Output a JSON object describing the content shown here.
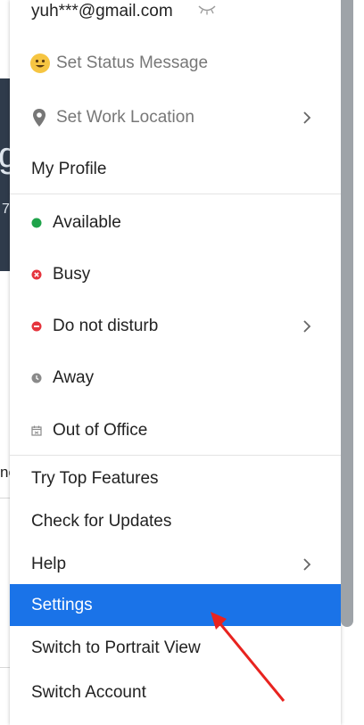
{
  "account": {
    "email": "yuh***@gmail.com"
  },
  "menu": {
    "set_status": "Set Status Message",
    "set_work_location": "Set Work Location",
    "my_profile": "My Profile",
    "presence": [
      {
        "label": "Available",
        "color": "#1fa34a"
      },
      {
        "label": "Busy",
        "color": "#e5343d"
      },
      {
        "label": "Do not disturb",
        "color": "#e5343d"
      },
      {
        "label": "Away",
        "color": "#8a8a8a"
      },
      {
        "label": "Out of Office",
        "color": "#8a8a8a"
      }
    ],
    "try_top_features": "Try Top Features",
    "check_updates": "Check for Updates",
    "help": "Help",
    "settings": "Settings",
    "switch_portrait": "Switch to Portrait View",
    "switch_account": "Switch Account"
  },
  "background": {
    "side_text": "ne"
  },
  "colors": {
    "accent": "#1a73e8",
    "annotation": "#e8231f"
  }
}
